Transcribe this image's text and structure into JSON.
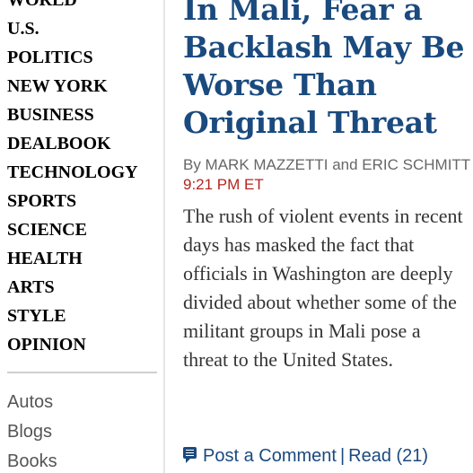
{
  "sidebar": {
    "sections": [
      "WORLD",
      "U.S.",
      "POLITICS",
      "NEW YORK",
      "BUSINESS",
      "DEALBOOK",
      "TECHNOLOGY",
      "SPORTS",
      "SCIENCE",
      "HEALTH",
      "ARTS",
      "STYLE",
      "OPINION"
    ],
    "more": [
      "Autos",
      "Blogs",
      "Books"
    ]
  },
  "article": {
    "headline": "In Mali, Fear a Backlash May Be Worse Than Original Threat",
    "byline_prefix": "By MARK MAZZETTI and ERIC SCHMITT",
    "time": "9:21 PM ET",
    "summary": "The rush of violent events in recent days has masked the fact that officials in Washington are deeply divided about whether some of the militant groups in Mali pose a threat to the United States.",
    "post_comment_label": "Post a Comment",
    "separator": "|",
    "read_label": "Read (21)"
  },
  "colors": {
    "headline": "#1a4a7e",
    "timestamp": "#b3261e",
    "byline": "#666666",
    "summary": "#333333",
    "more_links": "#555555"
  },
  "icons": {
    "comment": "speech-bubble-icon"
  }
}
